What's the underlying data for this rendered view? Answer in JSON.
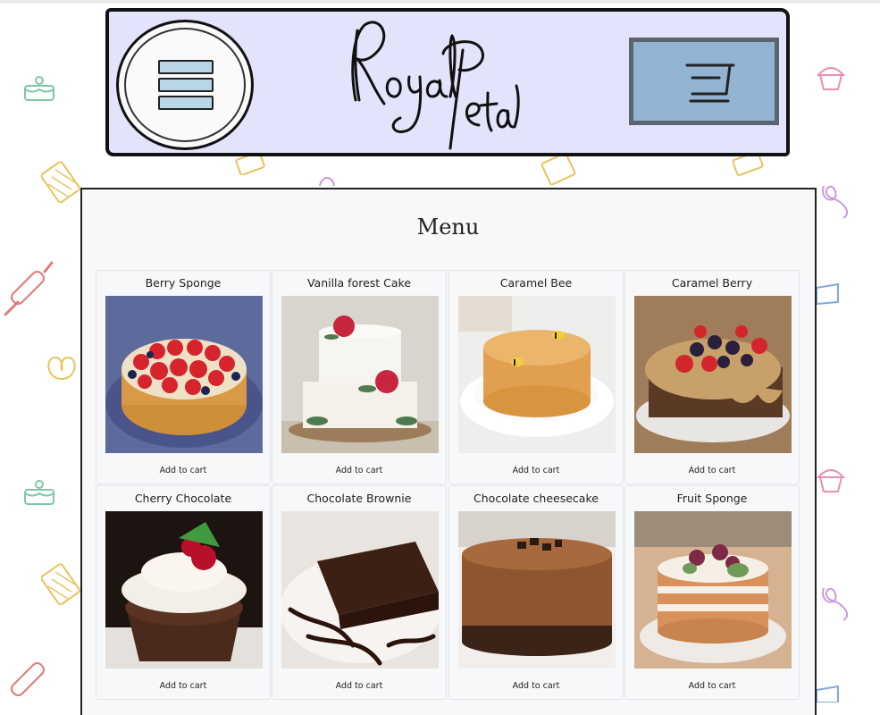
{
  "header": {
    "logo_text": "RoyalPetal",
    "menu_icon": "hamburger-menu-icon",
    "cart_icon": "shopping-cart-icon",
    "colors": {
      "banner": "#e3e3fb",
      "cart_button": "#92b3d2",
      "menu_bars": "#b8d6e6"
    }
  },
  "menu": {
    "title": "Menu",
    "items": [
      {
        "name": "Berry Sponge",
        "button": "Add to cart"
      },
      {
        "name": "Vanilla forest Cake",
        "button": "Add to cart"
      },
      {
        "name": "Caramel Bee",
        "button": "Add to cart"
      },
      {
        "name": "Caramel Berry",
        "button": "Add to cart"
      },
      {
        "name": "Cherry Chocolate",
        "button": "Add to cart"
      },
      {
        "name": "Chocolate Brownie",
        "button": "Add to cart"
      },
      {
        "name": "Chocolate cheesecake",
        "button": "Add to cart"
      },
      {
        "name": "Fruit Sponge",
        "button": "Add to cart"
      }
    ]
  },
  "background": {
    "doodles": [
      "cake-icon",
      "cupcake-icon",
      "waffle-icon",
      "rolling-pin-icon",
      "pretzel-icon",
      "ribbon-icon",
      "cake-slice-icon"
    ]
  }
}
